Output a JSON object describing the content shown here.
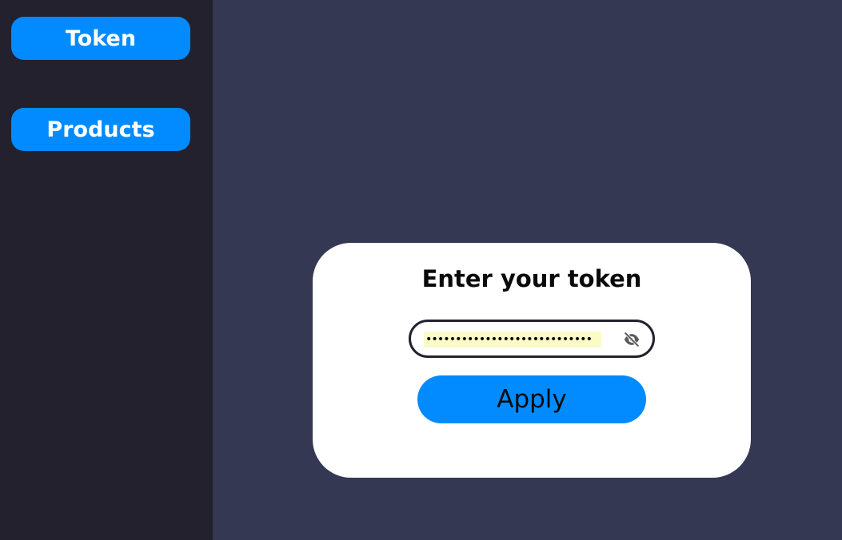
{
  "sidebar": {
    "items": [
      {
        "label": "Token"
      },
      {
        "label": "Products"
      }
    ]
  },
  "token_card": {
    "title": "Enter your token",
    "token_input": {
      "value": "••••••••••••••••••••••••••••",
      "type": "password"
    },
    "visibility_toggle_icon": "eye-off-icon",
    "apply_label": "Apply"
  },
  "colors": {
    "background": "#353853",
    "sidebar": "#23212d",
    "accent": "#018bff",
    "card": "#ffffff",
    "input_fill": "#fafbc7"
  }
}
